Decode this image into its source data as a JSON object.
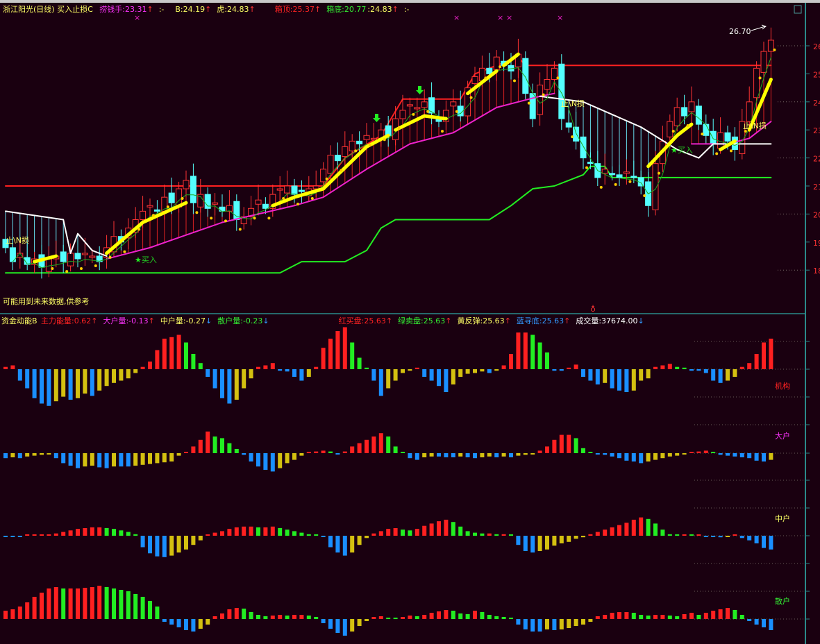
{
  "header": {
    "title": "浙江阳光(日线) 买入止损C",
    "items": [
      {
        "label": "捞钱手:23.31",
        "arrow": "↑",
        "color": "#ff33ff"
      },
      {
        "label": ":-",
        "arrow": "",
        "color": "#ffff66"
      },
      {
        "label": "B:24.19",
        "arrow": "↑",
        "color": "#ffff66"
      },
      {
        "label": "虎:24.83",
        "arrow": "↑",
        "color": "#ffff66"
      },
      {
        "label": "箱顶:25.37",
        "arrow": "↑",
        "color": "#ff2222"
      },
      {
        "label": "箱底:20.77",
        "arrow": "",
        "color": "#33ee33"
      },
      {
        "label": ":24.83",
        "arrow": "↑",
        "color": "#ffff66"
      },
      {
        "label": ":-",
        "arrow": "",
        "color": "#ffff66"
      }
    ]
  },
  "indicator_header": {
    "title": "资金动能B",
    "items": [
      {
        "label": "主力能量:0.62",
        "arrow": "↑",
        "color": "#ff2222"
      },
      {
        "label": "大户量:-0.13",
        "arrow": "↑",
        "color": "#ff33ff"
      },
      {
        "label": "中户量:-0.27",
        "arrow": "↓",
        "color": "#ffff66"
      },
      {
        "label": "散户量:-0.23",
        "arrow": "↓",
        "color": "#33ee33"
      },
      {
        "label": "红买盘:25.63",
        "arrow": "↑",
        "color": "#ff2222"
      },
      {
        "label": "绿卖盘:25.63",
        "arrow": "↑",
        "color": "#33ee33"
      },
      {
        "label": "黄反弹:25.63",
        "arrow": "↑",
        "color": "#ffff66"
      },
      {
        "label": "蓝寻底:25.63",
        "arrow": "↑",
        "color": "#3399ff"
      },
      {
        "label": "成交量:37674.00",
        "arrow": "↓",
        "color": "#ffffff"
      }
    ]
  },
  "annotations": {
    "warning": "可能用到未来数据,供参考",
    "stop_loss": "止\\N损",
    "buy": "买入",
    "buy_star": "★",
    "high_price": "26.70"
  },
  "price_axis": [
    "26",
    "25",
    "24",
    "23",
    "22",
    "21",
    "20",
    "19",
    "18"
  ],
  "panel_labels": [
    "机构",
    "大户",
    "中户",
    "散户"
  ],
  "colors": {
    "up": "#ff3333",
    "down": "#54ffff",
    "red": "#ff2020",
    "green": "#22ee22",
    "blue": "#1a8fff",
    "yellow": "#d4c010",
    "magenta": "#ee22cc",
    "thick": "#ffff00",
    "axis": "#2a8a8a"
  },
  "chart_data": {
    "type": "candlestick",
    "closes": [
      18.8,
      18.3,
      18.6,
      18.2,
      18.4,
      18.1,
      18.4,
      18.5,
      18.3,
      18.6,
      18.4,
      18.6,
      18.5,
      18.3,
      18.8,
      19.2,
      19.0,
      19.5,
      19.8,
      20.1,
      20.3,
      20.1,
      20.6,
      20.4,
      20.9,
      21.2,
      20.4,
      20.7,
      20.2,
      20.4,
      20.1,
      20.3,
      19.8,
      19.9,
      20.2,
      20.5,
      20.2,
      20.7,
      20.9,
      21.0,
      20.7,
      20.8,
      20.9,
      21.0,
      21.6,
      22.1,
      21.9,
      22.4,
      22.6,
      22.5,
      22.8,
      22.7,
      23.0,
      22.8,
      23.4,
      23.7,
      23.9,
      23.8,
      24.0,
      23.6,
      23.3,
      23.7,
      24.0,
      23.5,
      24.5,
      24.9,
      25.2,
      25.0,
      25.6,
      25.3,
      25.1,
      25.7,
      24.3,
      23.4,
      24.6,
      24.8,
      25.2,
      23.4,
      23.1,
      22.6,
      22.0,
      21.8,
      21.3,
      21.6,
      21.4,
      21.3,
      21.5,
      21.3,
      21.0,
      20.3,
      21.8,
      22.6,
      23.3,
      23.8,
      23.5,
      24.0,
      23.2,
      22.8,
      22.5,
      22.9,
      22.6,
      22.3,
      23.3,
      24.0,
      25.2,
      25.8,
      26.2
    ],
    "ylim": [
      17.2,
      27.0
    ],
    "lines": {
      "box_top": [
        [
          0,
          21.0
        ],
        [
          44,
          21.0
        ],
        [
          47,
          22.0
        ],
        [
          52,
          22.8
        ],
        [
          55,
          24.1
        ],
        [
          63,
          24.1
        ],
        [
          65,
          25.0
        ],
        [
          71,
          25.6
        ],
        [
          72,
          25.3
        ],
        [
          106,
          25.3
        ]
      ],
      "box_bottom": [
        [
          0,
          17.9
        ],
        [
          38,
          17.9
        ],
        [
          41,
          18.3
        ],
        [
          47,
          18.3
        ],
        [
          50,
          18.7
        ],
        [
          52,
          19.5
        ],
        [
          54,
          19.8
        ],
        [
          67,
          19.8
        ],
        [
          70,
          20.3
        ],
        [
          73,
          20.9
        ],
        [
          76,
          21.0
        ],
        [
          78,
          21.2
        ],
        [
          80,
          21.4
        ],
        [
          81,
          21.7
        ],
        [
          83,
          21.7
        ],
        [
          84,
          21.3
        ],
        [
          106,
          21.3
        ]
      ],
      "support": [
        [
          [
            14,
            18.4
          ],
          [
            20,
            18.8
          ],
          [
            30,
            19.7
          ],
          [
            40,
            20.3
          ],
          [
            44,
            20.6
          ],
          [
            50,
            21.6
          ],
          [
            56,
            22.5
          ],
          [
            62,
            22.9
          ],
          [
            68,
            23.8
          ],
          [
            74,
            24.2
          ],
          [
            76,
            24.3
          ]
        ],
        [
          [
            95,
            22.5
          ],
          [
            100,
            22.5
          ],
          [
            103,
            22.7
          ],
          [
            106,
            23.3
          ]
        ]
      ],
      "stop": [
        [
          [
            0,
            20.1
          ],
          [
            8,
            19.8
          ],
          [
            9,
            18.6
          ],
          [
            10,
            19.3
          ],
          [
            12,
            18.7
          ],
          [
            14,
            18.5
          ]
        ],
        [
          [
            74,
            24.2
          ],
          [
            80,
            24.0
          ],
          [
            88,
            23.1
          ],
          [
            93,
            22.3
          ],
          [
            96,
            22.0
          ],
          [
            98,
            22.5
          ],
          [
            106,
            22.5
          ]
        ]
      ],
      "trend": [
        [
          [
            4,
            18.3
          ],
          [
            7,
            18.5
          ]
        ],
        [
          [
            14,
            18.6
          ],
          [
            19,
            19.7
          ],
          [
            25,
            20.4
          ]
        ],
        [
          [
            37,
            20.3
          ],
          [
            40,
            20.6
          ],
          [
            44,
            20.9
          ]
        ],
        [
          [
            44,
            20.9
          ],
          [
            50,
            22.4
          ],
          [
            53,
            22.8
          ]
        ],
        [
          [
            54,
            23.0
          ],
          [
            58,
            23.5
          ],
          [
            61,
            23.4
          ]
        ],
        [
          [
            64,
            24.3
          ],
          [
            68,
            25.1
          ]
        ],
        [
          [
            69,
            25.3
          ],
          [
            71,
            25.7
          ]
        ],
        [
          [
            89,
            21.7
          ],
          [
            93,
            22.8
          ],
          [
            95,
            23.2
          ]
        ],
        [
          [
            99,
            22.3
          ],
          [
            101,
            22.6
          ]
        ],
        [
          [
            103,
            23.0
          ],
          [
            106,
            24.8
          ]
        ]
      ]
    },
    "panels": [
      {
        "name": "机构",
        "values": [
          0.3,
          0.5,
          -1.5,
          -2.5,
          -3.8,
          -4.5,
          -4.8,
          -4.2,
          -3.6,
          -4.0,
          -3.8,
          -3.2,
          -3.5,
          -2.8,
          -2.2,
          -1.8,
          -1.5,
          -1.2,
          -0.5,
          0.3,
          1.0,
          2.5,
          4.0,
          4.2,
          4.5,
          3.5,
          2.0,
          0.8,
          -1.0,
          -2.5,
          -3.8,
          -4.5,
          -4.0,
          -2.5,
          -1.2,
          0.3,
          0.5,
          0.8,
          -0.2,
          -0.3,
          -1.0,
          -1.5,
          -1.0,
          0.3,
          2.8,
          4.0,
          5.0,
          5.5,
          3.5,
          1.5,
          0.2,
          -1.5,
          -3.5,
          -2.5,
          -1.5,
          -0.5,
          -0.2,
          0.2,
          -1.0,
          -1.5,
          -2.2,
          -3.0,
          -2.0,
          -1.0,
          -0.6,
          -0.5,
          -0.3,
          -0.5,
          -0.2,
          0.5,
          2.0,
          4.8,
          4.8,
          4.5,
          3.5,
          2.2,
          -0.2,
          -0.2,
          0.2,
          0.6,
          -1.0,
          -1.5,
          -2.0,
          -1.8,
          -2.5,
          -2.8,
          -3.0,
          -2.8,
          -1.5,
          -1.2,
          0.3,
          0.5,
          0.7,
          0.3,
          0.2,
          -0.2,
          -0.2,
          -0.5,
          -1.5,
          -1.8,
          -1.5,
          -1.0,
          0.3,
          0.8,
          2.0,
          3.5,
          4.0
        ]
      },
      {
        "name": "大户",
        "values": [
          -0.6,
          -0.5,
          -0.6,
          -0.4,
          -0.3,
          -0.2,
          -0.1,
          -0.6,
          -1.2,
          -1.5,
          -1.8,
          -1.6,
          -1.5,
          -1.7,
          -1.8,
          -1.6,
          -1.6,
          -1.6,
          -1.5,
          -1.4,
          -1.3,
          -1.2,
          -1.1,
          -1.0,
          -0.3,
          0.1,
          0.8,
          1.6,
          2.6,
          2.0,
          1.8,
          1.2,
          0.5,
          -0.2,
          -1.0,
          -1.6,
          -2.0,
          -2.2,
          -1.8,
          -1.2,
          -0.8,
          -0.3,
          0.1,
          0.2,
          0.3,
          0.2,
          -0.1,
          0.2,
          0.8,
          1.2,
          1.6,
          2.0,
          2.4,
          2.0,
          0.8,
          0.1,
          -0.6,
          -0.8,
          -0.5,
          -0.4,
          -0.4,
          -0.5,
          -0.5,
          -0.4,
          -0.5,
          -0.6,
          -0.5,
          -0.4,
          -0.5,
          -0.4,
          -0.5,
          -0.3,
          -0.2,
          -0.1,
          0.3,
          0.8,
          1.6,
          2.2,
          2.2,
          1.8,
          0.6,
          0.1,
          -0.1,
          -0.2,
          -0.4,
          -0.6,
          -0.9,
          -1.0,
          -1.2,
          -1.0,
          -0.8,
          -0.6,
          -0.4,
          -0.3,
          -0.1,
          0.1,
          0.2,
          0.3,
          0.1,
          -0.2,
          -0.3,
          -0.4,
          -0.5,
          -0.6,
          -0.9,
          -1.0,
          -0.8
        ]
      },
      {
        "name": "中户",
        "values": [
          -0.1,
          -0.1,
          -0.1,
          0.0,
          0.0,
          0.1,
          0.1,
          0.3,
          0.5,
          0.7,
          0.9,
          1.0,
          1.1,
          1.1,
          1.0,
          0.9,
          0.7,
          0.5,
          0.2,
          -1.5,
          -2.3,
          -2.7,
          -2.8,
          -2.6,
          -2.2,
          -1.8,
          -1.2,
          -0.6,
          0.1,
          0.4,
          0.6,
          0.9,
          1.1,
          1.2,
          1.2,
          1.1,
          1.1,
          1.2,
          1.0,
          0.8,
          0.6,
          0.4,
          0.2,
          0.1,
          -0.1,
          -1.5,
          -2.2,
          -2.6,
          -2.2,
          -1.2,
          -0.3,
          0.3,
          0.6,
          0.9,
          1.0,
          0.8,
          0.7,
          0.9,
          1.3,
          1.6,
          1.9,
          2.1,
          1.8,
          1.2,
          0.6,
          0.4,
          0.3,
          0.3,
          0.2,
          0.2,
          0.1,
          -1.2,
          -2.0,
          -2.2,
          -2.0,
          -1.8,
          -1.3,
          -1.0,
          -0.8,
          -0.4,
          -0.2,
          0.2,
          0.5,
          0.8,
          1.1,
          1.4,
          1.7,
          2.1,
          2.4,
          2.2,
          1.6,
          0.8,
          0.2,
          0.1,
          0.1,
          0.0,
          0.0,
          -0.1,
          -0.1,
          -0.2,
          -0.1,
          0.1,
          -0.3,
          -0.6,
          -1.0,
          -1.6,
          -1.8
        ]
      },
      {
        "name": "散户",
        "values": [
          1.2,
          1.4,
          1.8,
          2.4,
          3.2,
          3.8,
          4.4,
          4.6,
          4.4,
          4.4,
          4.4,
          4.5,
          4.6,
          4.8,
          4.6,
          4.4,
          4.2,
          4.0,
          3.6,
          3.2,
          2.6,
          1.8,
          -0.4,
          -0.8,
          -1.2,
          -1.6,
          -1.8,
          -1.4,
          -0.8,
          0.4,
          0.8,
          1.4,
          1.6,
          1.5,
          1.0,
          0.6,
          0.4,
          0.5,
          0.6,
          0.5,
          0.6,
          0.6,
          0.5,
          0.3,
          -0.6,
          -1.4,
          -2.0,
          -2.4,
          -1.8,
          -1.0,
          -0.3,
          0.3,
          0.4,
          0.2,
          0.1,
          0.3,
          0.5,
          0.4,
          0.6,
          0.9,
          1.1,
          1.3,
          1.2,
          0.8,
          0.7,
          1.2,
          1.0,
          0.6,
          0.4,
          0.3,
          0.2,
          -0.8,
          -1.5,
          -1.8,
          -1.8,
          -1.5,
          -1.6,
          -1.5,
          -1.3,
          -1.0,
          -0.8,
          -0.4,
          0.4,
          0.6,
          0.9,
          1.0,
          1.0,
          0.9,
          0.6,
          0.5,
          0.6,
          0.6,
          0.5,
          0.4,
          0.7,
          0.9,
          0.6,
          0.9,
          1.2,
          1.4,
          1.6,
          1.3,
          0.6,
          -0.3,
          -0.8,
          -1.2,
          -1.6
        ]
      }
    ]
  }
}
